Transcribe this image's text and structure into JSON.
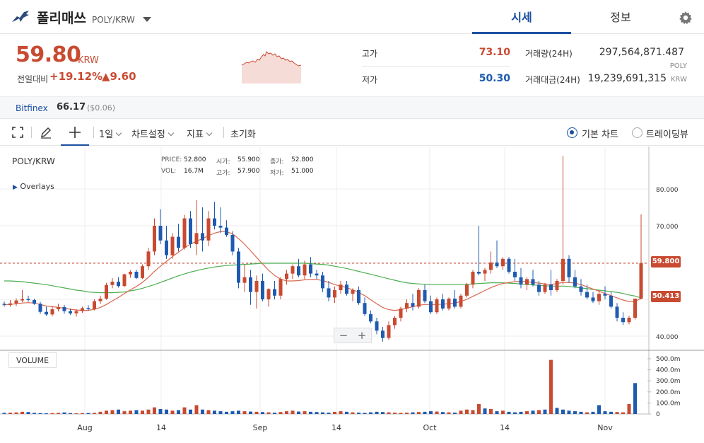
{
  "header": {
    "coin_name": "폴리매쓰",
    "pair": "POLY/KRW",
    "tabs": [
      "시세",
      "정보"
    ]
  },
  "price": {
    "current": "59.80",
    "unit": "KRW",
    "change_label": "전일대비",
    "change_pct": "+19.12%",
    "change_amt": "▲9.60"
  },
  "stats": {
    "high_label": "고가",
    "high": "73.10",
    "low_label": "저가",
    "low": "50.30",
    "volume_label": "거래량(24H)",
    "volume": "297,564,871.487",
    "volume_unit": "POLY",
    "value_label": "거래대금(24H)",
    "value": "19,239,691,315",
    "value_unit": "KRW"
  },
  "external": {
    "name": "Bitfinex",
    "price": "66.17",
    "usd": "($0.06)"
  },
  "toolbar": {
    "interval": "1일",
    "chart_settings": "차트설정",
    "indicators": "지표",
    "reset": "초기화",
    "radio_basic": "기본 차트",
    "radio_trading": "트레이딩뷰"
  },
  "colors": {
    "up": "#c84a31",
    "down": "#1e5bb0",
    "accent": "#1a4fa0",
    "ma_short": "#d9684f",
    "ma_long": "#4caf50"
  },
  "chart_info": {
    "symbol": "POLY/KRW",
    "overlays": "Overlays",
    "price_label": "PRICE:",
    "price": "52.800",
    "open_label": "시가:",
    "open": "55.900",
    "close_label": "종가:",
    "close": "52.800",
    "vol_label": "VOL:",
    "vol": "16.7M",
    "high_label": "고가:",
    "high": "57.900",
    "low_label": "저가:",
    "low": "51.000",
    "current_tag": "59.800",
    "ma_tag": "50.413",
    "volume_badge": "VOLUME",
    "zoom_minus": "−",
    "zoom_plus": "+"
  },
  "chart_data": {
    "type": "candlestick",
    "price_axis": {
      "min": 40,
      "max": 80,
      "ticks": [
        "40.000",
        "50.000",
        "60.000",
        "70.000",
        "80.000"
      ]
    },
    "volume_axis": {
      "ticks": [
        "0",
        "100.0m",
        "200.0m",
        "300.0m",
        "400.0m",
        "500.0m"
      ]
    },
    "x_labels": [
      "Aug",
      "14",
      "Sep",
      "14",
      "Oct",
      "14",
      "Nov"
    ],
    "candles": [
      {
        "o": 48.8,
        "h": 49.4,
        "l": 48.0,
        "c": 48.5
      },
      {
        "o": 48.5,
        "h": 49.8,
        "l": 48.0,
        "c": 48.9
      },
      {
        "o": 48.9,
        "h": 50.3,
        "l": 48.2,
        "c": 49.7
      },
      {
        "o": 49.7,
        "h": 52.5,
        "l": 49.2,
        "c": 50.1
      },
      {
        "o": 50.1,
        "h": 51.0,
        "l": 49.3,
        "c": 49.8
      },
      {
        "o": 49.8,
        "h": 50.2,
        "l": 48.5,
        "c": 48.8
      },
      {
        "o": 48.8,
        "h": 49.3,
        "l": 46.0,
        "c": 46.6
      },
      {
        "o": 46.6,
        "h": 48.0,
        "l": 45.5,
        "c": 45.9
      },
      {
        "o": 45.9,
        "h": 48.2,
        "l": 45.4,
        "c": 47.3
      },
      {
        "o": 47.3,
        "h": 48.8,
        "l": 46.7,
        "c": 47.9
      },
      {
        "o": 47.9,
        "h": 48.5,
        "l": 46.1,
        "c": 46.8
      },
      {
        "o": 46.8,
        "h": 47.5,
        "l": 45.8,
        "c": 46.2
      },
      {
        "o": 46.2,
        "h": 47.4,
        "l": 45.3,
        "c": 46.8
      },
      {
        "o": 46.8,
        "h": 48.0,
        "l": 46.3,
        "c": 47.6
      },
      {
        "o": 47.6,
        "h": 48.4,
        "l": 47.0,
        "c": 47.3
      },
      {
        "o": 47.3,
        "h": 50.0,
        "l": 47.0,
        "c": 49.5
      },
      {
        "o": 49.5,
        "h": 51.0,
        "l": 48.8,
        "c": 50.2
      },
      {
        "o": 50.2,
        "h": 54.5,
        "l": 49.9,
        "c": 53.9
      },
      {
        "o": 53.9,
        "h": 55.8,
        "l": 53.0,
        "c": 54.8
      },
      {
        "o": 54.8,
        "h": 56.0,
        "l": 53.2,
        "c": 53.6
      },
      {
        "o": 53.6,
        "h": 57.0,
        "l": 53.4,
        "c": 56.8
      },
      {
        "o": 56.8,
        "h": 57.9,
        "l": 55.9,
        "c": 57.5
      },
      {
        "o": 57.5,
        "h": 58.0,
        "l": 55.5,
        "c": 55.8
      },
      {
        "o": 55.8,
        "h": 59.5,
        "l": 55.5,
        "c": 59.0
      },
      {
        "o": 59.0,
        "h": 64.0,
        "l": 58.0,
        "c": 63.0
      },
      {
        "o": 63.0,
        "h": 72.0,
        "l": 62.0,
        "c": 70.0
      },
      {
        "o": 70.0,
        "h": 74.5,
        "l": 65.0,
        "c": 66.0
      },
      {
        "o": 66.0,
        "h": 70.0,
        "l": 61.0,
        "c": 62.0
      },
      {
        "o": 62.0,
        "h": 68.0,
        "l": 61.0,
        "c": 67.0
      },
      {
        "o": 67.0,
        "h": 70.5,
        "l": 63.0,
        "c": 64.0
      },
      {
        "o": 64.0,
        "h": 73.0,
        "l": 63.5,
        "c": 72.0
      },
      {
        "o": 72.0,
        "h": 74.0,
        "l": 64.0,
        "c": 65.0
      },
      {
        "o": 65.0,
        "h": 77.0,
        "l": 62.0,
        "c": 68.0
      },
      {
        "o": 68.0,
        "h": 75.0,
        "l": 63.0,
        "c": 66.0
      },
      {
        "o": 66.0,
        "h": 74.0,
        "l": 64.5,
        "c": 72.0
      },
      {
        "o": 72.0,
        "h": 76.5,
        "l": 69.0,
        "c": 70.0
      },
      {
        "o": 70.0,
        "h": 75.0,
        "l": 68.0,
        "c": 69.5
      },
      {
        "o": 69.5,
        "h": 71.5,
        "l": 67.0,
        "c": 67.5
      },
      {
        "o": 67.5,
        "h": 68.5,
        "l": 62.0,
        "c": 63.0
      },
      {
        "o": 63.0,
        "h": 64.0,
        "l": 53.0,
        "c": 54.5
      },
      {
        "o": 54.5,
        "h": 59.5,
        "l": 52.0,
        "c": 56.0
      },
      {
        "o": 56.0,
        "h": 58.0,
        "l": 48.5,
        "c": 52.0
      },
      {
        "o": 52.0,
        "h": 56.5,
        "l": 47.5,
        "c": 55.0
      },
      {
        "o": 55.0,
        "h": 57.0,
        "l": 49.5,
        "c": 50.0
      },
      {
        "o": 50.0,
        "h": 53.0,
        "l": 48.0,
        "c": 52.8
      },
      {
        "o": 52.8,
        "h": 55.0,
        "l": 50.0,
        "c": 51.0
      },
      {
        "o": 51.0,
        "h": 56.0,
        "l": 50.0,
        "c": 55.5
      },
      {
        "o": 55.5,
        "h": 58.0,
        "l": 54.0,
        "c": 57.0
      },
      {
        "o": 57.0,
        "h": 59.5,
        "l": 55.5,
        "c": 59.0
      },
      {
        "o": 59.0,
        "h": 61.0,
        "l": 56.0,
        "c": 56.5
      },
      {
        "o": 56.5,
        "h": 60.5,
        "l": 55.5,
        "c": 59.5
      },
      {
        "o": 59.5,
        "h": 61.5,
        "l": 56.0,
        "c": 57.0
      },
      {
        "o": 57.0,
        "h": 58.0,
        "l": 55.5,
        "c": 56.5
      },
      {
        "o": 56.5,
        "h": 57.5,
        "l": 52.0,
        "c": 53.0
      },
      {
        "o": 53.0,
        "h": 55.0,
        "l": 49.5,
        "c": 50.5
      },
      {
        "o": 50.5,
        "h": 53.5,
        "l": 49.0,
        "c": 52.5
      },
      {
        "o": 52.5,
        "h": 55.0,
        "l": 51.5,
        "c": 54.0
      },
      {
        "o": 54.0,
        "h": 55.0,
        "l": 51.0,
        "c": 51.5
      },
      {
        "o": 51.5,
        "h": 53.0,
        "l": 49.5,
        "c": 52.5
      },
      {
        "o": 52.5,
        "h": 53.5,
        "l": 48.5,
        "c": 49.0
      },
      {
        "o": 49.0,
        "h": 50.5,
        "l": 45.5,
        "c": 46.0
      },
      {
        "o": 46.0,
        "h": 47.0,
        "l": 43.5,
        "c": 44.0
      },
      {
        "o": 44.0,
        "h": 45.0,
        "l": 40.5,
        "c": 41.5
      },
      {
        "o": 41.5,
        "h": 42.5,
        "l": 38.5,
        "c": 39.5
      },
      {
        "o": 39.5,
        "h": 44.0,
        "l": 39.0,
        "c": 43.0
      },
      {
        "o": 43.0,
        "h": 45.5,
        "l": 42.0,
        "c": 45.0
      },
      {
        "o": 45.0,
        "h": 48.0,
        "l": 44.0,
        "c": 47.5
      },
      {
        "o": 47.5,
        "h": 50.0,
        "l": 46.5,
        "c": 49.0
      },
      {
        "o": 49.0,
        "h": 51.5,
        "l": 47.0,
        "c": 48.0
      },
      {
        "o": 48.0,
        "h": 53.0,
        "l": 47.5,
        "c": 52.5
      },
      {
        "o": 52.5,
        "h": 54.0,
        "l": 49.0,
        "c": 49.5
      },
      {
        "o": 49.5,
        "h": 51.0,
        "l": 46.0,
        "c": 46.5
      },
      {
        "o": 46.5,
        "h": 50.5,
        "l": 46.0,
        "c": 50.0
      },
      {
        "o": 50.0,
        "h": 51.5,
        "l": 47.0,
        "c": 47.5
      },
      {
        "o": 47.5,
        "h": 50.5,
        "l": 47.0,
        "c": 50.2
      },
      {
        "o": 50.2,
        "h": 52.5,
        "l": 47.5,
        "c": 48.0
      },
      {
        "o": 48.0,
        "h": 51.5,
        "l": 47.5,
        "c": 51.0
      },
      {
        "o": 51.0,
        "h": 54.5,
        "l": 50.5,
        "c": 54.0
      },
      {
        "o": 54.0,
        "h": 58.0,
        "l": 53.0,
        "c": 57.5
      },
      {
        "o": 57.5,
        "h": 70.0,
        "l": 56.5,
        "c": 57.0
      },
      {
        "o": 57.0,
        "h": 58.5,
        "l": 55.0,
        "c": 58.0
      },
      {
        "o": 58.0,
        "h": 63.0,
        "l": 57.0,
        "c": 60.0
      },
      {
        "o": 60.0,
        "h": 66.0,
        "l": 58.5,
        "c": 59.0
      },
      {
        "o": 59.0,
        "h": 61.5,
        "l": 58.0,
        "c": 61.0
      },
      {
        "o": 61.0,
        "h": 61.5,
        "l": 57.0,
        "c": 57.5
      },
      {
        "o": 57.5,
        "h": 61.0,
        "l": 55.0,
        "c": 56.0
      },
      {
        "o": 56.0,
        "h": 58.5,
        "l": 53.0,
        "c": 54.0
      },
      {
        "o": 54.0,
        "h": 56.0,
        "l": 52.5,
        "c": 55.5
      },
      {
        "o": 55.5,
        "h": 58.0,
        "l": 53.5,
        "c": 54.0
      },
      {
        "o": 54.0,
        "h": 55.0,
        "l": 51.0,
        "c": 52.0
      },
      {
        "o": 52.0,
        "h": 54.5,
        "l": 51.5,
        "c": 54.0
      },
      {
        "o": 54.0,
        "h": 58.0,
        "l": 51.0,
        "c": 52.5
      },
      {
        "o": 52.5,
        "h": 55.5,
        "l": 52.0,
        "c": 55.0
      },
      {
        "o": 55.0,
        "h": 89.0,
        "l": 54.0,
        "c": 61.0
      },
      {
        "o": 61.0,
        "h": 62.0,
        "l": 54.5,
        "c": 56.0
      },
      {
        "o": 56.0,
        "h": 58.0,
        "l": 53.0,
        "c": 53.5
      },
      {
        "o": 53.5,
        "h": 55.5,
        "l": 51.0,
        "c": 52.0
      },
      {
        "o": 52.0,
        "h": 54.0,
        "l": 50.0,
        "c": 50.5
      },
      {
        "o": 50.5,
        "h": 52.0,
        "l": 49.0,
        "c": 49.5
      },
      {
        "o": 49.5,
        "h": 52.5,
        "l": 48.5,
        "c": 51.5
      },
      {
        "o": 51.5,
        "h": 53.5,
        "l": 50.0,
        "c": 51.0
      },
      {
        "o": 51.0,
        "h": 52.0,
        "l": 47.5,
        "c": 48.0
      },
      {
        "o": 48.0,
        "h": 49.0,
        "l": 44.0,
        "c": 45.0
      },
      {
        "o": 45.0,
        "h": 46.5,
        "l": 43.0,
        "c": 43.8
      },
      {
        "o": 43.8,
        "h": 45.5,
        "l": 43.2,
        "c": 45.0
      },
      {
        "o": 45.0,
        "h": 47.5,
        "l": 44.5,
        "c": 50.2
      },
      {
        "o": 50.2,
        "h": 73.1,
        "l": 50.0,
        "c": 59.8
      }
    ],
    "ma_short": [
      48.5,
      48.6,
      48.8,
      49.0,
      49.1,
      49.0,
      48.6,
      48.2,
      48.0,
      47.8,
      47.6,
      47.3,
      47.1,
      47.0,
      47.0,
      47.3,
      47.8,
      48.6,
      49.6,
      50.5,
      51.6,
      52.6,
      53.5,
      54.6,
      56.0,
      57.6,
      59.0,
      60.3,
      61.6,
      62.8,
      64.0,
      65.0,
      65.8,
      66.5,
      67.3,
      68.0,
      68.4,
      68.4,
      67.8,
      66.5,
      65.0,
      63.2,
      61.4,
      59.6,
      57.9,
      56.5,
      55.5,
      55.0,
      55.0,
      55.1,
      55.3,
      55.4,
      55.4,
      55.1,
      54.6,
      54.0,
      53.6,
      53.2,
      52.6,
      51.9,
      51.0,
      49.9,
      48.8,
      47.8,
      47.2,
      47.0,
      47.2,
      47.6,
      48.0,
      48.4,
      48.6,
      48.6,
      48.6,
      48.7,
      48.8,
      49.0,
      49.4,
      50.0,
      50.8,
      51.6,
      52.4,
      53.2,
      53.8,
      54.3,
      54.6,
      54.8,
      54.9,
      54.8,
      54.6,
      54.4,
      54.2,
      54.0,
      54.3,
      54.6,
      54.6,
      54.4,
      54.0,
      53.4,
      52.8,
      52.2,
      51.6,
      51.0,
      50.4,
      49.8,
      49.4,
      49.5,
      50.2
    ],
    "ma_long": [
      55.0,
      55.0,
      54.9,
      54.8,
      54.6,
      54.4,
      54.2,
      54.0,
      53.7,
      53.4,
      53.1,
      52.8,
      52.5,
      52.3,
      52.0,
      51.9,
      51.8,
      51.8,
      51.8,
      51.9,
      52.0,
      52.3,
      52.6,
      53.0,
      53.5,
      54.0,
      54.6,
      55.2,
      55.8,
      56.4,
      56.9,
      57.4,
      57.8,
      58.2,
      58.5,
      58.8,
      59.0,
      59.2,
      59.3,
      59.4,
      59.5,
      59.6,
      59.7,
      59.8,
      59.8,
      59.8,
      59.8,
      59.8,
      59.8,
      59.8,
      59.8,
      59.7,
      59.6,
      59.5,
      59.3,
      59.0,
      58.7,
      58.4,
      58.0,
      57.6,
      57.2,
      56.8,
      56.4,
      56.0,
      55.6,
      55.2,
      54.8,
      54.5,
      54.3,
      54.2,
      54.1,
      54.0,
      54.0,
      54.0,
      54.0,
      54.0,
      54.0,
      54.1,
      54.2,
      54.3,
      54.4,
      54.5,
      54.5,
      54.5,
      54.4,
      54.3,
      54.2,
      54.0,
      53.9,
      53.8,
      53.7,
      53.6,
      53.6,
      53.6,
      53.5,
      53.3,
      53.1,
      52.9,
      52.7,
      52.5,
      52.3,
      52.1,
      51.9,
      51.6,
      51.2,
      50.9,
      50.4
    ],
    "volumes": [
      10,
      12,
      14,
      20,
      18,
      10,
      8,
      6,
      8,
      10,
      14,
      8,
      6,
      8,
      9,
      10,
      20,
      30,
      35,
      40,
      25,
      30,
      35,
      30,
      40,
      60,
      45,
      40,
      30,
      35,
      60,
      40,
      80,
      40,
      35,
      30,
      25,
      20,
      25,
      30,
      25,
      22,
      20,
      18,
      15,
      12,
      18,
      25,
      30,
      22,
      25,
      20,
      18,
      15,
      12,
      20,
      25,
      20,
      15,
      12,
      10,
      15,
      20,
      18,
      15,
      12,
      10,
      12,
      15,
      18,
      20,
      25,
      22,
      18,
      15,
      12,
      30,
      40,
      35,
      90,
      50,
      45,
      25,
      30,
      20,
      15,
      20,
      25,
      30,
      35,
      40,
      490,
      55,
      40,
      30,
      25,
      20,
      15,
      20,
      80,
      25,
      20,
      18,
      15,
      90,
      280
    ],
    "volume_up_flags": [
      0,
      1,
      1,
      1,
      0,
      0,
      0,
      0,
      1,
      1,
      0,
      0,
      1,
      1,
      0,
      1,
      1,
      1,
      1,
      0,
      1,
      1,
      0,
      1,
      1,
      1,
      0,
      0,
      1,
      0,
      1,
      0,
      1,
      0,
      1,
      0,
      0,
      0,
      0,
      0,
      1,
      0,
      1,
      0,
      1,
      0,
      1,
      1,
      1,
      0,
      1,
      0,
      0,
      0,
      0,
      1,
      1,
      0,
      1,
      0,
      0,
      0,
      0,
      0,
      1,
      1,
      1,
      1,
      0,
      1,
      0,
      0,
      1,
      0,
      1,
      0,
      1,
      1,
      1,
      1,
      0,
      1,
      0,
      1,
      0,
      0,
      0,
      1,
      0,
      1,
      0,
      1,
      0,
      0,
      0,
      0,
      0,
      1,
      0,
      0,
      0,
      0,
      1,
      1,
      1
    ]
  }
}
